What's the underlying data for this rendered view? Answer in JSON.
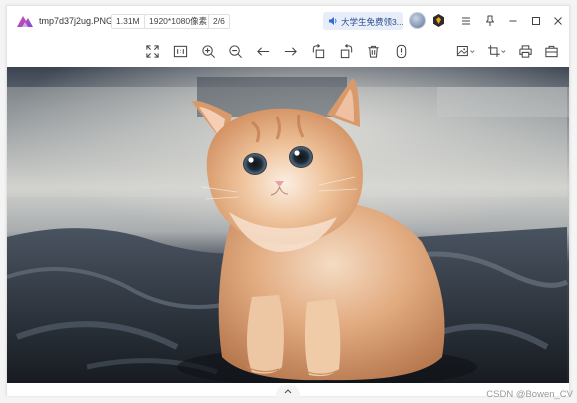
{
  "title_bar": {
    "file_name": "tmp7d37j2ug.PNG",
    "file_size": "1.31M",
    "resolution": "1920*1080像素",
    "page_indicator": "2/6",
    "promo_text": "大学生免费领3...",
    "icons": {
      "app_logo": "app-logo",
      "promo": "speaker-icon",
      "avatar": "user-avatar",
      "vip": "vip-hexagon-icon",
      "menu": "hamburger-menu-icon",
      "pin": "pin-icon",
      "minimize": "minimize-icon",
      "maximize": "maximize-icon",
      "close": "close-icon"
    }
  },
  "toolbar": {
    "tools": [
      {
        "name": "fit-screen",
        "icon": "fit-screen-icon"
      },
      {
        "name": "original-size",
        "icon": "original-size-icon"
      },
      {
        "name": "zoom-in",
        "icon": "zoom-in-icon"
      },
      {
        "name": "zoom-out",
        "icon": "zoom-out-icon"
      },
      {
        "name": "previous",
        "icon": "arrow-left-icon"
      },
      {
        "name": "next",
        "icon": "arrow-right-icon"
      },
      {
        "name": "rotate-left",
        "icon": "rotate-left-icon"
      },
      {
        "name": "rotate-right",
        "icon": "rotate-right-icon"
      },
      {
        "name": "delete",
        "icon": "trash-icon"
      },
      {
        "name": "info",
        "icon": "info-icon"
      },
      {
        "name": "image-edit",
        "icon": "image-edit-icon"
      },
      {
        "name": "crop",
        "icon": "crop-icon"
      },
      {
        "name": "print",
        "icon": "printer-icon"
      },
      {
        "name": "toolbox",
        "icon": "toolbox-icon"
      }
    ]
  },
  "viewer": {
    "image_subject": "kitten-photo",
    "expand_handle_icon": "chevron-up-icon"
  },
  "watermark": "CSDN @Bowen_CV",
  "colors": {
    "accent": "#2c4c8c",
    "promo_bg": "#e8eef9",
    "window_bg": "#ffffff",
    "logo_purple": "#7b4de0",
    "logo_pink": "#e14a9c"
  }
}
